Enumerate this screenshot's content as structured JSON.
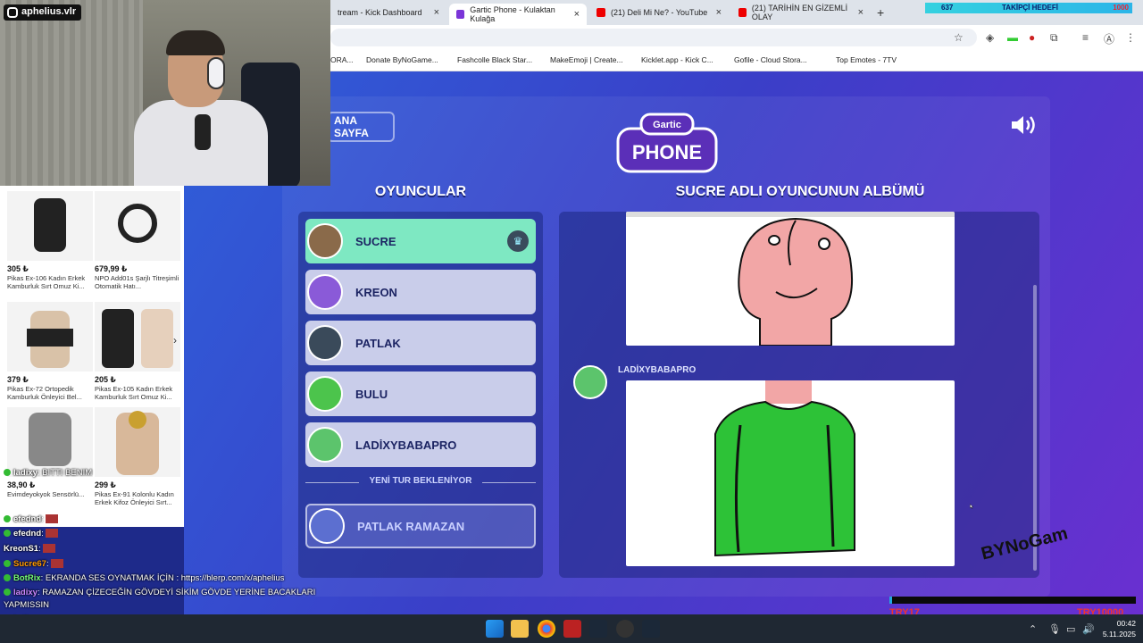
{
  "tabs": [
    {
      "label": "tream - Kick Dashboard",
      "close": "×"
    },
    {
      "label": "Gartic Phone - Kulaktan Kulağa",
      "close": "×"
    },
    {
      "label": "(21) Deli Mi Ne? - YouTube",
      "close": "×"
    },
    {
      "label": "(21) TARİHİN EN GİZEMLİ OLAY",
      "close": "×"
    }
  ],
  "new_tab": "+",
  "follower_goal": {
    "count": "637",
    "label": "TAKİPÇİ HEDEFİ",
    "goal": "1000"
  },
  "bookmarks": [
    "ORA...",
    "Donate ByNoGame...",
    "Fashcolle Black Star...",
    "MakeEmoji | Create...",
    "Kicklet.app - Kick C...",
    "Gofile - Cloud Stora...",
    "Top Emotes - 7TV"
  ],
  "home_button": "ANA SAYFA",
  "logo": {
    "line1": "Gartic",
    "line2": "PHONE"
  },
  "players_title": "OYUNCULAR",
  "album_title": "SUCRE ADLI OYUNCUNUN ALBÜMÜ",
  "players": [
    {
      "name": "SUCRE",
      "active": true
    },
    {
      "name": "KREON",
      "active": false
    },
    {
      "name": "PATLAK",
      "active": false
    },
    {
      "name": "BULU",
      "active": false
    },
    {
      "name": "LADİXYBABAPRO",
      "active": false
    }
  ],
  "waiting_label": "YENİ TUR BEKLENİYOR",
  "waiting_player": "PATLAK RAMAZAN",
  "drawing_author": "LADİXYBABAPRO",
  "streamer_name": "aphelius.vlr",
  "shop": [
    {
      "price": "305 ₺",
      "desc": "Pikas Ex-106 Kadın Erkek Kamburluk Sırt Omuz Ki..."
    },
    {
      "price": "679,99 ₺",
      "desc": "NPO Add01s Şarjlı Titreşimli Otomatik Hatı..."
    },
    {
      "price": "379 ₺",
      "desc": "Pikas Ex-72 Ortopedik Kamburluk Önleyici Bel..."
    },
    {
      "price": "205 ₺",
      "desc": "Pikas Ex-105 Kadın Erkek Kamburluk Sırt Omuz Ki..."
    },
    {
      "price": "38,90 ₺",
      "desc": "Evimdeyokyok Sensörlü..."
    },
    {
      "price": "299 ₺",
      "desc": "Pikas Ex-91 Kolonlu Kadın Erkek Kifoz Önleyici Sırt..."
    }
  ],
  "chat": [
    {
      "user": "ladixy",
      "text": ": BITTI BENIM"
    },
    {
      "user": "efednd",
      "text": ":"
    },
    {
      "user": "efednd",
      "text": ":"
    },
    {
      "user": "KreonS1",
      "text": ":"
    },
    {
      "user": "Sucre67",
      "text": ":"
    },
    {
      "user": "BotRix",
      "text": ": EKRANDA SES OYNATMAK İÇİN : https://blerp.com/x/aphelius"
    },
    {
      "user": "ladixy",
      "text": ": RAMAZAN ÇİZECEĞİN GÖVDEYİ SİKİM GÖVDE YERİNE BACAKLARI"
    },
    {
      "user": "",
      "text": "YAPMISSIN"
    },
    {
      "user": "ladixy",
      "text": ":"
    },
    {
      "user": "efednd",
      "text": ":"
    }
  ],
  "watermark": "BYNoGam",
  "stream_goal": {
    "left": "TRY17",
    "right": "TRY10000"
  },
  "clock": {
    "time": "00:42",
    "date": "5.11.2025"
  },
  "colors": {
    "active_player": "#7ee8c2",
    "player": "#c9cdea",
    "accent": "#6a2fd0"
  }
}
